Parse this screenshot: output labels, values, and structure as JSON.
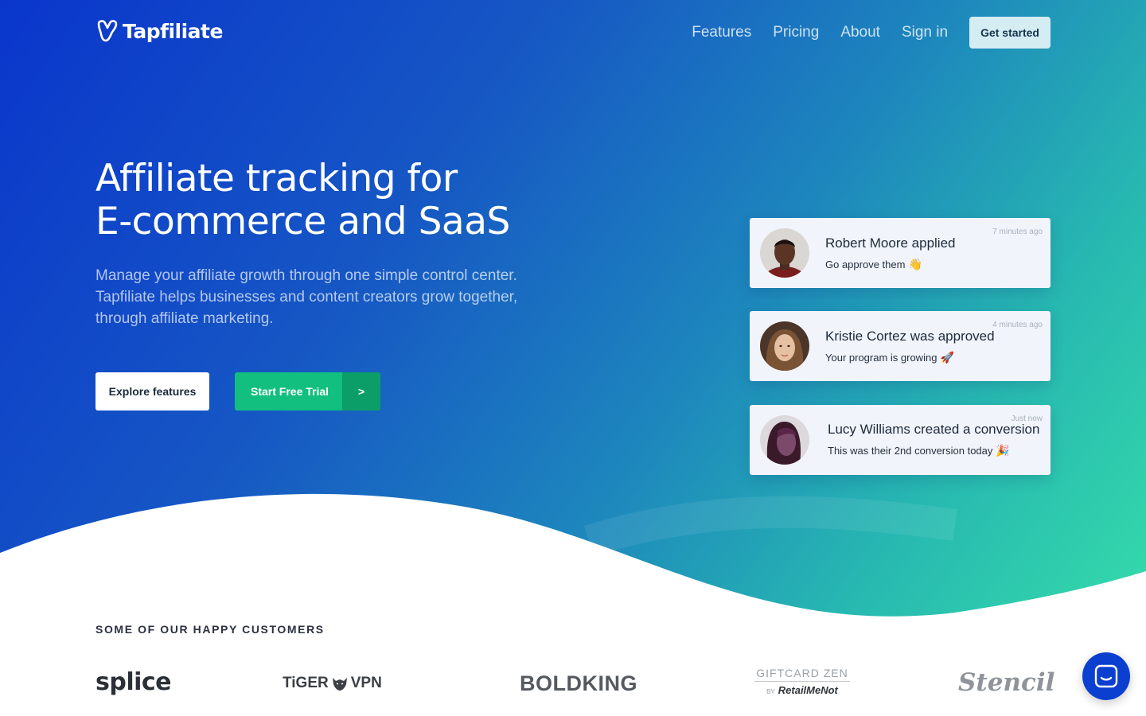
{
  "brand": {
    "name": "Tapfiliate"
  },
  "nav": {
    "links": [
      "Features",
      "Pricing",
      "About",
      "Sign in"
    ],
    "cta": "Get started"
  },
  "hero": {
    "headline": [
      "Affiliate tracking for",
      "E-commerce and SaaS"
    ],
    "subtext": [
      "Manage your affiliate growth through one simple control center.",
      "Tapfiliate helps businesses and content creators grow together,",
      "through affiliate marketing."
    ],
    "explore_label": "Explore features",
    "trial_label": "Start Free Trial",
    "trial_arrow": ">"
  },
  "notifications": [
    {
      "title": "Robert Moore applied",
      "message": "Go approve them",
      "emoji": "👋",
      "time": "7 minutes ago"
    },
    {
      "title": "Kristie Cortez was approved",
      "message": "Your program is growing",
      "emoji": "🚀",
      "time": "4 minutes ago"
    },
    {
      "title": "Lucy Williams created a conversion",
      "message": "This was their 2nd conversion today",
      "emoji": "🎉",
      "time": "Just now"
    }
  ],
  "customers": {
    "heading": "SOME OF OUR HAPPY CUSTOMERS",
    "logos": {
      "splice": "splice",
      "tiger_left": "TiGER",
      "tiger_right": "VPN",
      "boldking": "BOLDKING",
      "giftcard_top": "GIFTCARD ZEN",
      "giftcard_by": "BY",
      "giftcard_bottom": "RetailMeNot",
      "stencil": "Stencil"
    }
  },
  "colors": {
    "gradient_start": "#0a36cc",
    "gradient_end": "#34dbaa",
    "trial_green": "#12bf7f",
    "chat_blue": "#0a3fcf"
  },
  "icons": [
    "tapfiliate-logo-icon",
    "chat-icon"
  ]
}
